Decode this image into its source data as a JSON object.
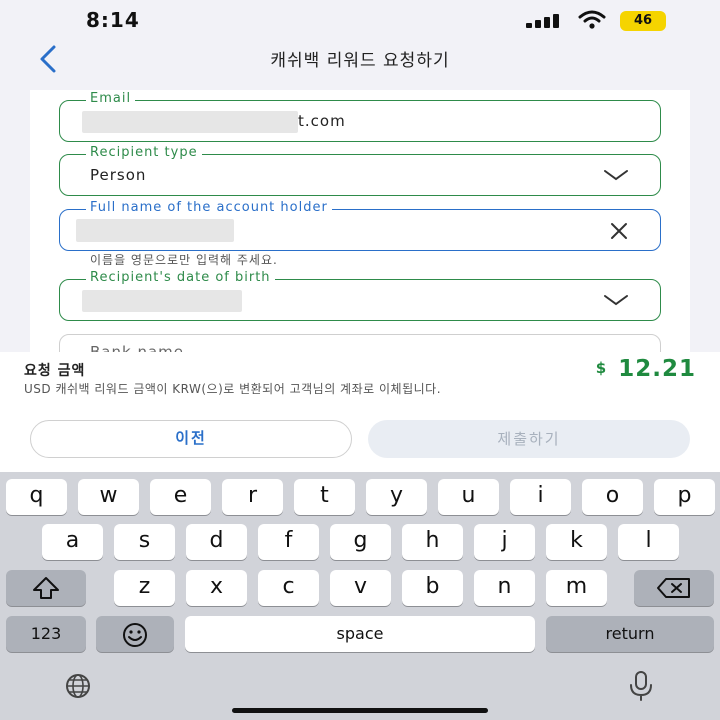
{
  "status_bar": {
    "time": "8:14",
    "battery": "46"
  },
  "nav": {
    "title": "캐쉬백 리워드 요청하기"
  },
  "form": {
    "email": {
      "label": "Email",
      "value_suffix": "t.com"
    },
    "recipient_type": {
      "label": "Recipient type",
      "value": "Person"
    },
    "full_name": {
      "label": "Full name of the account holder",
      "helper": "이름을 영문으로만 입력해 주세요."
    },
    "dob": {
      "label": "Recipient's date of birth"
    },
    "bank": {
      "label": "Bank name"
    }
  },
  "summary": {
    "title": "요청 금액",
    "description": "USD 캐쉬백 리워드 금액이 KRW(으)로 변환되어 고객님의 계좌로 이체됩니다.",
    "currency": "$",
    "amount": "12.21"
  },
  "buttons": {
    "prev": "이전",
    "submit": "제출하기"
  },
  "keyboard": {
    "row1": [
      "q",
      "w",
      "e",
      "r",
      "t",
      "y",
      "u",
      "i",
      "o",
      "p"
    ],
    "row2": [
      "a",
      "s",
      "d",
      "f",
      "g",
      "h",
      "j",
      "k",
      "l"
    ],
    "row3": [
      "z",
      "x",
      "c",
      "v",
      "b",
      "n",
      "m"
    ],
    "numbers": "123",
    "space": "space",
    "return": "return"
  },
  "colors": {
    "accent_green": "#2e8b4a",
    "focus_blue": "#2a6fc9",
    "amount_green": "#1f8a3f"
  }
}
